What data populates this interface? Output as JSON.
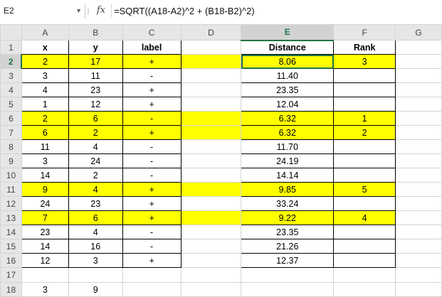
{
  "name_box": {
    "value": "E2"
  },
  "formula_bar": {
    "fx_label": "fx",
    "formula": "=SQRT((A18-A2)^2 + (B18-B2)^2)"
  },
  "columns": [
    "A",
    "B",
    "C",
    "D",
    "E",
    "F",
    "G"
  ],
  "selected_column": "E",
  "selected_row": 2,
  "rows": [
    {
      "num": "1",
      "A": "x",
      "B": "y",
      "C": "label",
      "D": "",
      "E": "Distance",
      "F": "Rank",
      "hl": false,
      "header": true
    },
    {
      "num": "2",
      "A": "2",
      "B": "17",
      "C": "+",
      "D": "",
      "E": "8.06",
      "F": "3",
      "hl": true
    },
    {
      "num": "3",
      "A": "3",
      "B": "11",
      "C": "-",
      "D": "",
      "E": "11.40",
      "F": "",
      "hl": false
    },
    {
      "num": "4",
      "A": "4",
      "B": "23",
      "C": "+",
      "D": "",
      "E": "23.35",
      "F": "",
      "hl": false
    },
    {
      "num": "5",
      "A": "1",
      "B": "12",
      "C": "+",
      "D": "",
      "E": "12.04",
      "F": "",
      "hl": false
    },
    {
      "num": "6",
      "A": "2",
      "B": "6",
      "C": "-",
      "D": "",
      "E": "6.32",
      "F": "1",
      "hl": true
    },
    {
      "num": "7",
      "A": "6",
      "B": "2",
      "C": "+",
      "D": "",
      "E": "6.32",
      "F": "2",
      "hl": true
    },
    {
      "num": "8",
      "A": "11",
      "B": "4",
      "C": "-",
      "D": "",
      "E": "11.70",
      "F": "",
      "hl": false
    },
    {
      "num": "9",
      "A": "3",
      "B": "24",
      "C": "-",
      "D": "",
      "E": "24.19",
      "F": "",
      "hl": false
    },
    {
      "num": "10",
      "A": "14",
      "B": "2",
      "C": "-",
      "D": "",
      "E": "14.14",
      "F": "",
      "hl": false
    },
    {
      "num": "11",
      "A": "9",
      "B": "4",
      "C": "+",
      "D": "",
      "E": "9.85",
      "F": "5",
      "hl": true
    },
    {
      "num": "12",
      "A": "24",
      "B": "23",
      "C": "+",
      "D": "",
      "E": "33.24",
      "F": "",
      "hl": false
    },
    {
      "num": "13",
      "A": "7",
      "B": "6",
      "C": "+",
      "D": "",
      "E": "9.22",
      "F": "4",
      "hl": true
    },
    {
      "num": "14",
      "A": "23",
      "B": "4",
      "C": "-",
      "D": "",
      "E": "23.35",
      "F": "",
      "hl": false
    },
    {
      "num": "15",
      "A": "14",
      "B": "16",
      "C": "-",
      "D": "",
      "E": "21.26",
      "F": "",
      "hl": false
    },
    {
      "num": "16",
      "A": "12",
      "B": "3",
      "C": "+",
      "D": "",
      "E": "12.37",
      "F": "",
      "hl": false
    },
    {
      "num": "17",
      "A": "",
      "B": "",
      "C": "",
      "D": "",
      "E": "",
      "F": "",
      "hl": false,
      "blank": true
    },
    {
      "num": "18",
      "A": "3",
      "B": "9",
      "C": "",
      "D": "",
      "E": "",
      "F": "",
      "hl": false,
      "blank": true
    }
  ],
  "colors": {
    "highlight": "#ffff00",
    "selection": "#217346"
  }
}
